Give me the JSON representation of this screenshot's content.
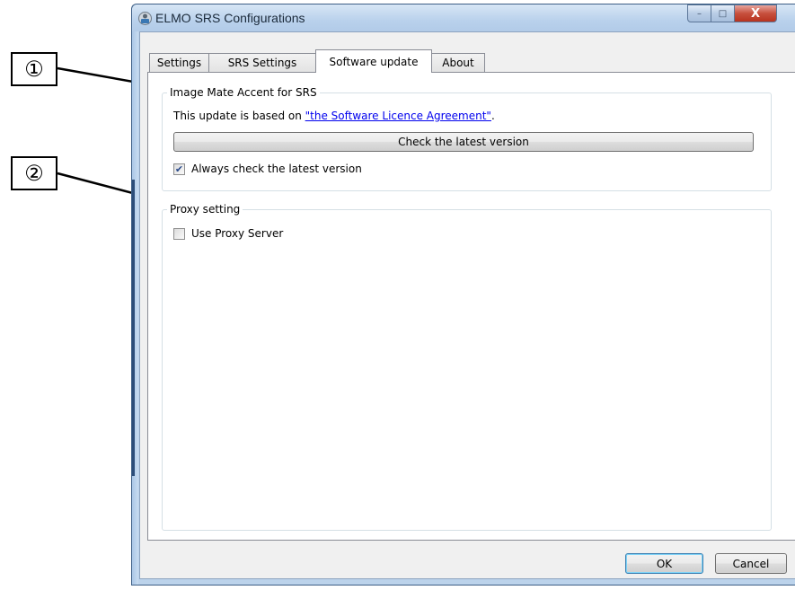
{
  "callouts": [
    "①",
    "②"
  ],
  "window": {
    "title": "ELMO SRS Configurations",
    "controls": {
      "minimize": "–",
      "maximize": "□",
      "close": "X"
    }
  },
  "tabs": [
    {
      "label": "Settings"
    },
    {
      "label": "SRS Settings"
    },
    {
      "label": "Software update"
    },
    {
      "label": "About"
    }
  ],
  "update_group": {
    "title": "Image Mate Accent for SRS",
    "info_prefix": "This update is based on ",
    "info_link": "\"the Software Licence Agreement\"",
    "info_suffix": ".",
    "check_button": "Check the latest version",
    "always_check_label": "Always check the latest version",
    "always_check_checked": true
  },
  "proxy_group": {
    "title": "Proxy setting",
    "use_proxy_label": "Use Proxy Server",
    "use_proxy_checked": false
  },
  "buttons": {
    "ok": "OK",
    "cancel": "Cancel"
  }
}
